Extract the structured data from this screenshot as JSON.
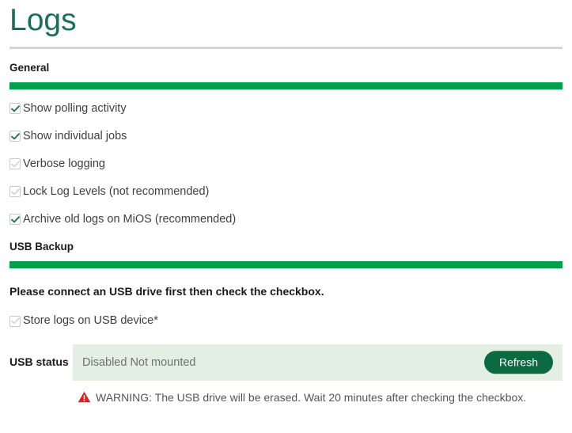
{
  "page": {
    "title": "Logs"
  },
  "sections": {
    "general": {
      "heading": "General",
      "options": [
        {
          "label": "Show polling activity",
          "checked": true,
          "enabled": true
        },
        {
          "label": "Show individual jobs",
          "checked": true,
          "enabled": true
        },
        {
          "label": "Verbose logging",
          "checked": false,
          "enabled": false
        },
        {
          "label": "Lock Log Levels (not recommended)",
          "checked": false,
          "enabled": false
        },
        {
          "label": "Archive old logs on MiOS (recommended)",
          "checked": true,
          "enabled": true
        }
      ]
    },
    "usb_backup": {
      "heading": "USB Backup",
      "hint": "Please connect an USB drive first then check the checkbox.",
      "option": {
        "label": "Store logs on USB device*",
        "checked": false,
        "enabled": false
      },
      "status_label": "USB status",
      "status_value": "Disabled Not mounted",
      "refresh_label": "Refresh",
      "warning_text": "WARNING: The USB drive will be erased. Wait 20 minutes after checking the checkbox.",
      "warning_icon": "warning-triangle-icon"
    }
  },
  "colors": {
    "title": "#197155",
    "section_bar": "#00a04a",
    "panel_background": "#e3efe3",
    "button": "#0b6b40",
    "warning": "#e02020",
    "checkmark_on": "#1d7a3e",
    "checkmark_off": "#d6d6d6"
  }
}
